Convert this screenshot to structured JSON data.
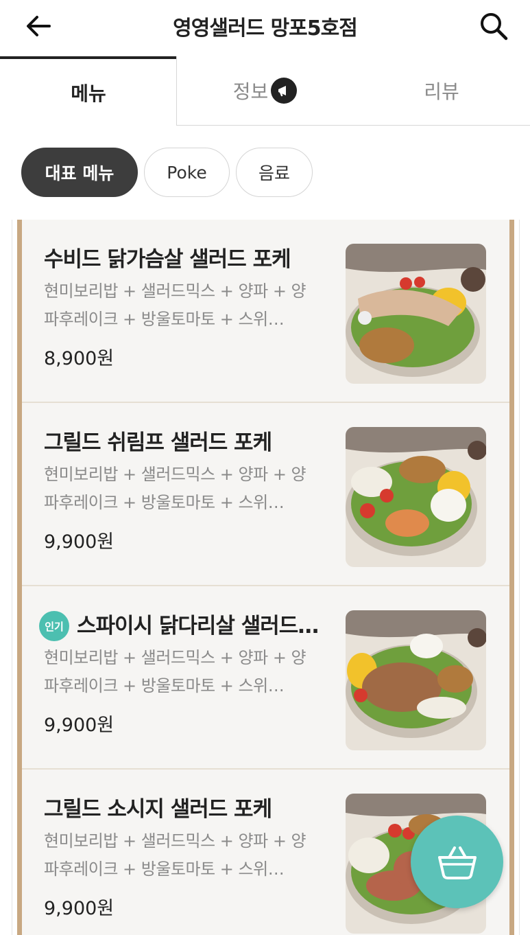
{
  "header": {
    "title": "영영샐러드 망포5호점",
    "back_icon": "arrow-left-icon",
    "search_icon": "search-icon"
  },
  "tabs": [
    {
      "label": "메뉴",
      "active": true
    },
    {
      "label": "정보",
      "active": false,
      "icon": "megaphone-icon"
    },
    {
      "label": "리뷰",
      "active": false
    }
  ],
  "categories": [
    {
      "label": "대표 메뉴",
      "selected": true
    },
    {
      "label": "Poke",
      "selected": false
    },
    {
      "label": "음료",
      "selected": false
    }
  ],
  "menu_items": [
    {
      "name": "수비드 닭가슴살 샐러드 포케",
      "desc_line1": "현미보리밥 + 샐러드믹스 + 양파 + 양",
      "desc_line2": "파후레이크 + 방울토마토 + 스위…",
      "price": "8,900원"
    },
    {
      "name": "그릴드 쉬림프 샐러드 포케",
      "desc_line1": "현미보리밥 + 샐러드믹스 + 양파 + 양",
      "desc_line2": "파후레이크 + 방울토마토 + 스위…",
      "price": "9,900원"
    },
    {
      "badge": "인기",
      "name": "스파이시 닭다리살 샐러드…",
      "desc_line1": "현미보리밥 + 샐러드믹스 + 양파 + 양",
      "desc_line2": "파후레이크 + 방울토마토 + 스위…",
      "price": "9,900원"
    },
    {
      "name": "그릴드 소시지 샐러드 포케",
      "desc_line1": "현미보리밥 + 샐러드믹스 + 양파 + 양",
      "desc_line2": "파후레이크 + 방울토마토 + 스위…",
      "price": "9,900원"
    }
  ],
  "cart": {
    "icon": "basket-icon"
  },
  "colors": {
    "accent": "#5cc2b8",
    "chip_selected": "#3d3d3d",
    "frame_rail": "#c8a882",
    "popular_badge": "#4cbfb0"
  }
}
